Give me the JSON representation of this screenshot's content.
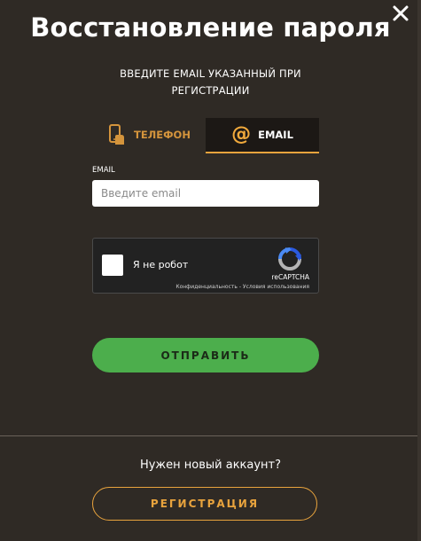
{
  "modal": {
    "title": "Восстановление пароля",
    "subtitle_line1": "ВВЕДИТЕ EMAIL УКАЗАННЫЙ ПРИ",
    "subtitle_line2": "РЕГИСТРАЦИИ",
    "close_icon": "close-icon"
  },
  "tabs": [
    {
      "label": "ТЕЛЕФОН",
      "icon": "phone-hand-icon",
      "active": false
    },
    {
      "label": "EMAIL",
      "icon": "at-icon",
      "icon_glyph": "@",
      "active": true
    }
  ],
  "email_field": {
    "label": "EMAIL",
    "placeholder": "Введите email",
    "value": ""
  },
  "recaptcha": {
    "label": "Я не робот",
    "brand": "reCAPTCHA",
    "links": "Конфиденциальность - Условия использования",
    "icon": "recaptcha-logo-icon"
  },
  "submit": {
    "label": "ОТПРАВИТЬ"
  },
  "footer": {
    "prompt": "Нужен новый аккаунт?",
    "register_label": "РЕГИСТРАЦИЯ"
  },
  "colors": {
    "background": "#2f2a25",
    "accent": "#e8a33d",
    "submit": "#4cae4c"
  }
}
